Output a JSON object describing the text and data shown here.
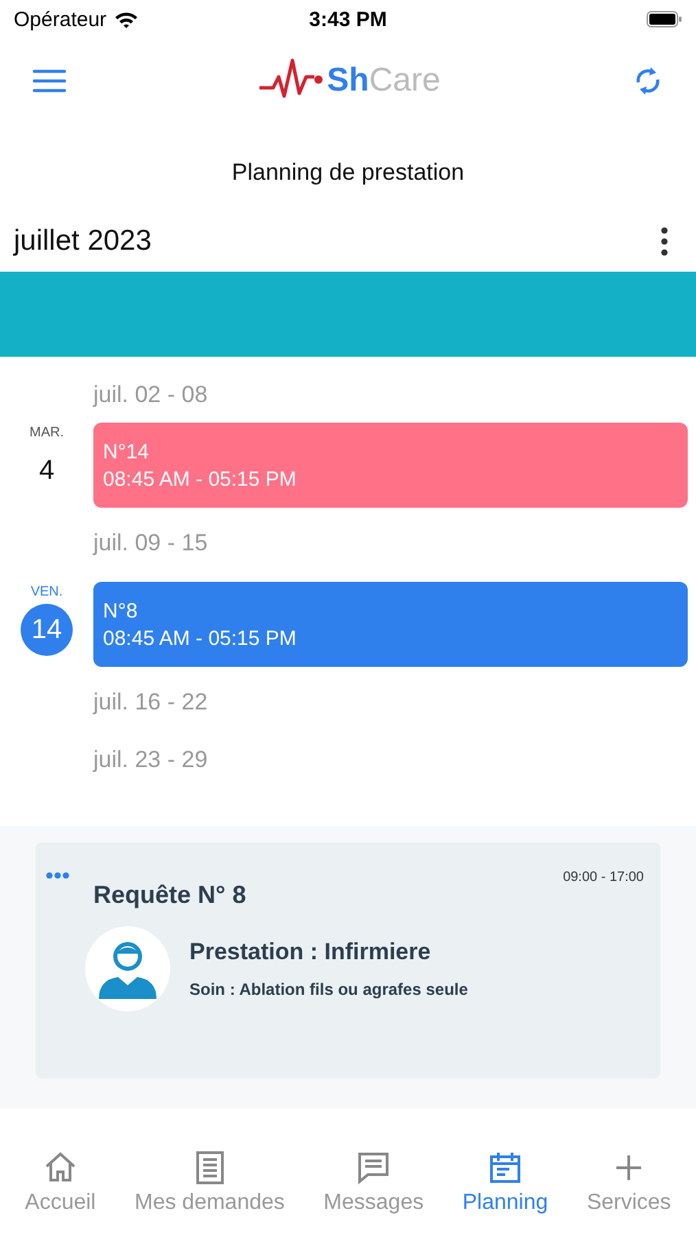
{
  "status_bar": {
    "carrier": "Opérateur",
    "time": "3:43 PM"
  },
  "header": {
    "logo_accent": "Sh",
    "logo_rest": "Care"
  },
  "page_title": "Planning de prestation",
  "month": "juillet 2023",
  "agenda": [
    {
      "kind": "week",
      "label": "juil. 02 - 08"
    },
    {
      "kind": "event",
      "weekday": "MAR.",
      "day": "4",
      "today": false,
      "title": "N°14",
      "time": "08:45 AM - 05:15 PM",
      "color": "#fe7187"
    },
    {
      "kind": "week",
      "label": "juil. 09 - 15"
    },
    {
      "kind": "event",
      "weekday": "VEN.",
      "day": "14",
      "today": true,
      "title": "N°8",
      "time": "08:45 AM - 05:15 PM",
      "color": "#2f80ed"
    },
    {
      "kind": "week",
      "label": "juil. 16 - 22"
    },
    {
      "kind": "week",
      "label": "juil. 23 - 29"
    }
  ],
  "detail": {
    "title": "Requête N° 8",
    "time": "09:00 - 17:00",
    "service": "Prestation : Infirmiere",
    "care": "Soin : Ablation fils ou agrafes seule"
  },
  "tabs": [
    {
      "label": "Accueil",
      "selected": false
    },
    {
      "label": "Mes demandes",
      "selected": false
    },
    {
      "label": "Messages",
      "selected": false
    },
    {
      "label": "Planning",
      "selected": true
    },
    {
      "label": "Services",
      "selected": false
    }
  ]
}
